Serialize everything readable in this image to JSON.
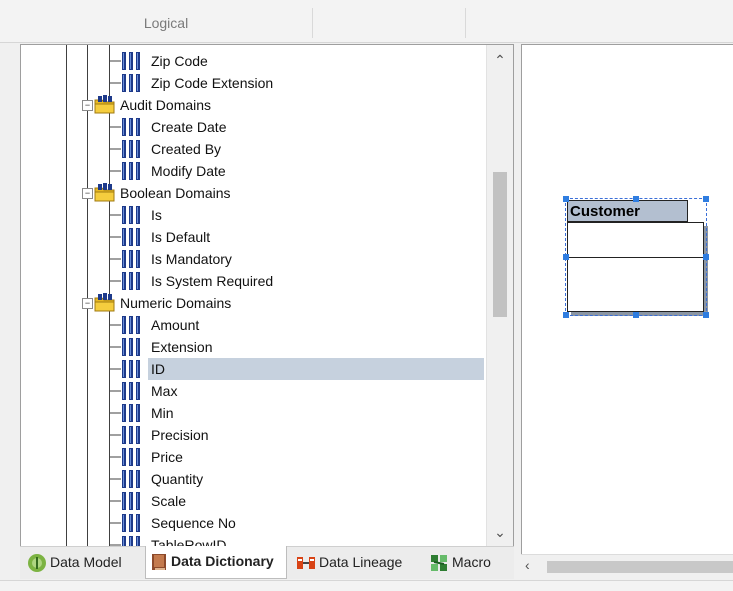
{
  "header": {
    "tabs": [
      {
        "label": "Logical"
      },
      {
        "label": ""
      }
    ]
  },
  "tree": {
    "selected_label": "ID",
    "items": [
      {
        "type": "column",
        "label": "Zip Code"
      },
      {
        "type": "column",
        "label": "Zip Code Extension"
      },
      {
        "type": "folder",
        "label": "Audit Domains"
      },
      {
        "type": "column",
        "label": "Create Date"
      },
      {
        "type": "column",
        "label": "Created By"
      },
      {
        "type": "column",
        "label": "Modify Date"
      },
      {
        "type": "folder",
        "label": "Boolean Domains"
      },
      {
        "type": "column",
        "label": "Is"
      },
      {
        "type": "column",
        "label": "Is Default"
      },
      {
        "type": "column",
        "label": "Is Mandatory"
      },
      {
        "type": "column",
        "label": "Is System Required"
      },
      {
        "type": "folder",
        "label": "Numeric Domains"
      },
      {
        "type": "column",
        "label": "Amount"
      },
      {
        "type": "column",
        "label": "Extension"
      },
      {
        "type": "column",
        "label": "ID"
      },
      {
        "type": "column",
        "label": "Max"
      },
      {
        "type": "column",
        "label": "Min"
      },
      {
        "type": "column",
        "label": "Precision"
      },
      {
        "type": "column",
        "label": "Price"
      },
      {
        "type": "column",
        "label": "Quantity"
      },
      {
        "type": "column",
        "label": "Scale"
      },
      {
        "type": "column",
        "label": "Sequence No"
      },
      {
        "type": "column",
        "label": "TableRowID"
      }
    ]
  },
  "bottom_tabs": [
    {
      "label": "Data Model",
      "icon": "data-model-icon",
      "active": false
    },
    {
      "label": "Data Dictionary",
      "icon": "data-dictionary-icon",
      "active": true
    },
    {
      "label": "Data Lineage",
      "icon": "data-lineage-icon",
      "active": false
    },
    {
      "label": "Macro",
      "icon": "macro-icon",
      "active": false
    }
  ],
  "diagram": {
    "entity_title": "Customer"
  },
  "colors": {
    "selection": "#c6d1de",
    "entity_header": "#b3bfd0",
    "handle": "#2f7de0"
  }
}
